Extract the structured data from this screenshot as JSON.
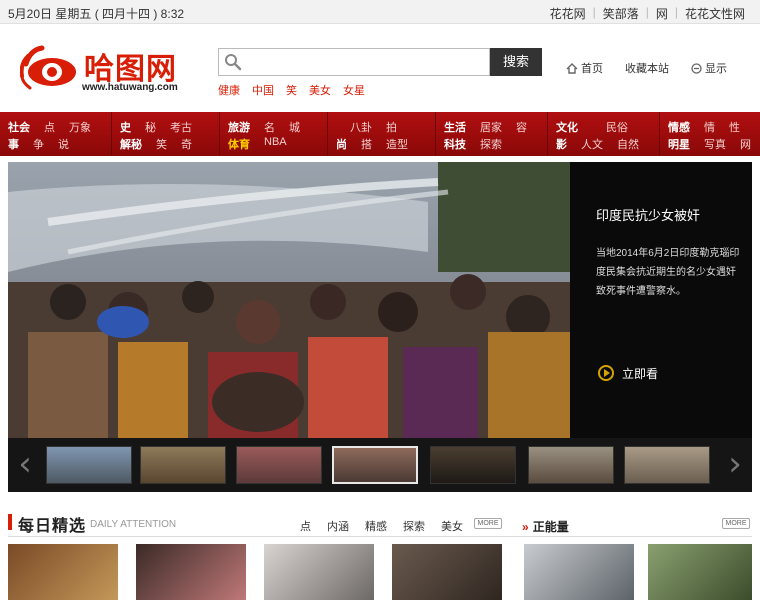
{
  "topbar": {
    "date": "5月20日 星期五 ( 四月十四 ) 8:32",
    "links": [
      "花花网",
      "笑部落",
      "网",
      "花花文性网"
    ]
  },
  "logo": {
    "name": "哈图网",
    "url": "www.hatuwang.com",
    "brand_color": "#d81e06"
  },
  "search": {
    "placeholder": "",
    "value": "",
    "button_label": "搜索",
    "hotwords": [
      "健康",
      "中国",
      "笑",
      "美女",
      "女星"
    ]
  },
  "header_links": [
    {
      "icon": "home-icon",
      "label": "首页"
    },
    {
      "icon": "bookmark-icon",
      "label": "收藏本站"
    },
    {
      "icon": "display-icon",
      "label": "显示"
    }
  ],
  "nav": {
    "groups": [
      {
        "row1": [
          "社会",
          "点",
          "万象"
        ],
        "row2": [
          "事",
          "争",
          "说"
        ],
        "highlight": []
      },
      {
        "row1": [
          "史",
          "秘",
          "考古"
        ],
        "row2": [
          "解秘",
          "笑",
          "奇"
        ],
        "highlight": []
      },
      {
        "row1": [
          "旅游",
          "名",
          "城"
        ],
        "row2": [
          "体育",
          "NBA"
        ],
        "highlight": [
          "体育"
        ]
      },
      {
        "row1": [
          "",
          "八卦",
          "拍"
        ],
        "row2": [
          "尚",
          "搭",
          "造型"
        ],
        "highlight": []
      },
      {
        "row1": [
          "生活",
          "居家",
          "容"
        ],
        "row2": [
          "科技",
          "探索",
          ""
        ],
        "highlight": []
      },
      {
        "row1": [
          "文化",
          "",
          "民俗"
        ],
        "row2": [
          "影",
          "人文",
          "自然"
        ],
        "highlight": []
      },
      {
        "row1": [
          "情感",
          "情",
          "性"
        ],
        "row2": [
          "明星",
          "写真",
          "网"
        ],
        "highlight": []
      }
    ]
  },
  "slide": {
    "title": "印度民抗少女被奸",
    "description": "当地2014年6月2日印度勒克瑙印度民集会抗近期生的名少女遇奸致死事件遭警察水。",
    "button_label": "立即看",
    "accent_color": "#d5a300"
  },
  "daily": {
    "title": "每日精选",
    "title_en": "DAILY ATTENTION",
    "tabs": [
      "点",
      "内涵",
      "精感",
      "探索",
      "美女"
    ],
    "more_label": "MORE",
    "section2_title": "正能量"
  }
}
